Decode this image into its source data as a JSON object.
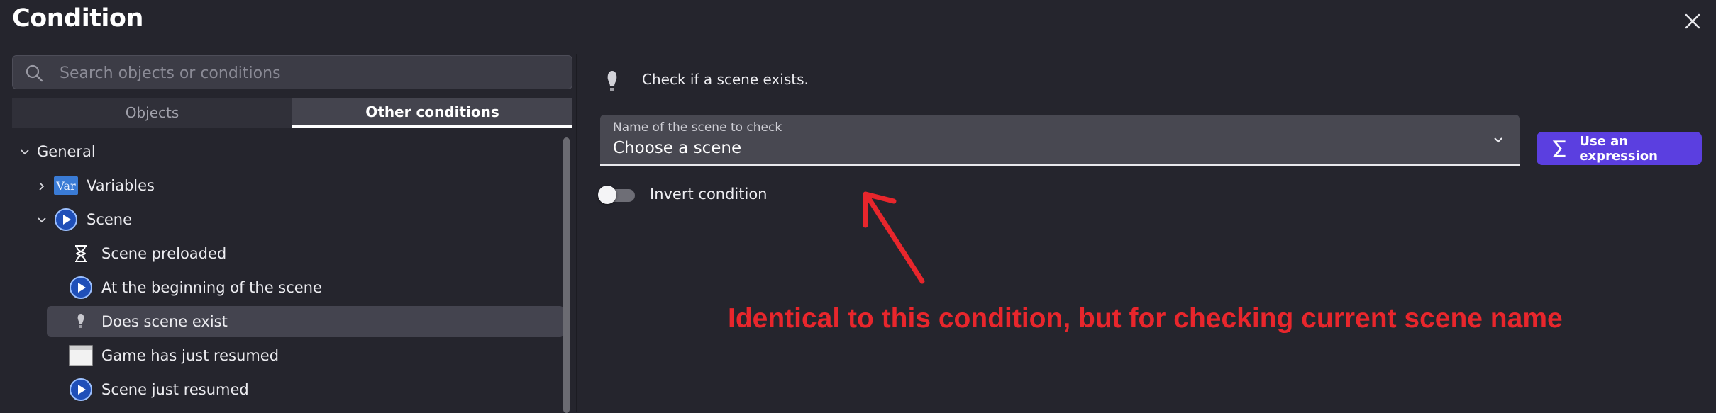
{
  "dialog": {
    "title": "Condition"
  },
  "search": {
    "placeholder": "Search objects or conditions",
    "icon": "search-icon"
  },
  "tabs": [
    {
      "label": "Objects",
      "active": false
    },
    {
      "label": "Other conditions",
      "active": true
    }
  ],
  "tree": {
    "items": [
      {
        "label": "General",
        "expanded": true,
        "level": 0
      },
      {
        "label": "Variables",
        "expanded": false,
        "level": 1,
        "icon": "variable-icon",
        "icon_text": "Var"
      },
      {
        "label": "Scene",
        "expanded": true,
        "level": 1,
        "icon": "scene-play-icon"
      },
      {
        "label": "Scene preloaded",
        "level": 2,
        "icon": "hourglass-icon"
      },
      {
        "label": "At the beginning of the scene",
        "level": 2,
        "icon": "scene-play-icon"
      },
      {
        "label": "Does scene exist",
        "level": 2,
        "icon": "lightbulb-icon",
        "selected": true
      },
      {
        "label": "Game has just resumed",
        "level": 2,
        "icon": "window-icon"
      },
      {
        "label": "Scene just resumed",
        "level": 2,
        "icon": "scene-play-icon"
      }
    ]
  },
  "condition": {
    "description": "Check if a scene exists.",
    "field": {
      "label": "Name of the scene to check",
      "value": "Choose a scene"
    },
    "expression_button": "Use an expression",
    "invert_label": "Invert condition",
    "invert": false
  },
  "annotation": {
    "text": "Identical to this condition, but for checking current scene name",
    "color": "#e8262c"
  },
  "colors": {
    "accent": "#5b3fe0",
    "background": "#25252d"
  }
}
